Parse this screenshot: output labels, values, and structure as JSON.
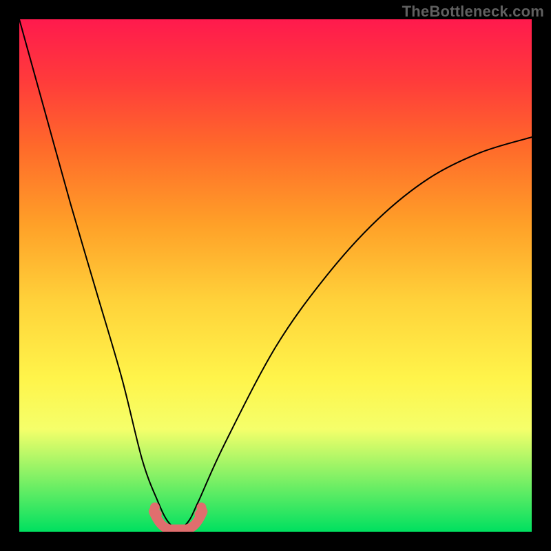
{
  "watermark": "TheBottleneck.com",
  "chart_data": {
    "type": "line",
    "title": "",
    "xlabel": "",
    "ylabel": "",
    "xlim": [
      0,
      1
    ],
    "ylim": [
      0,
      1
    ],
    "note": "Axes are implicit and unlabeled in the image; x/y are normalized 0–1 estimates read from pixel positions.",
    "series": [
      {
        "name": "bottleneck-curve",
        "x": [
          0.0,
          0.05,
          0.1,
          0.15,
          0.2,
          0.24,
          0.27,
          0.29,
          0.31,
          0.33,
          0.35,
          0.4,
          0.5,
          0.6,
          0.7,
          0.8,
          0.9,
          1.0
        ],
        "y": [
          1.0,
          0.82,
          0.64,
          0.47,
          0.3,
          0.14,
          0.06,
          0.02,
          0.005,
          0.02,
          0.06,
          0.17,
          0.36,
          0.5,
          0.61,
          0.69,
          0.74,
          0.77
        ]
      }
    ],
    "min_region": {
      "x_start": 0.27,
      "x_end": 0.35,
      "y": 0.01
    },
    "background_gradient": {
      "top": "#ff1a4d",
      "bottom": "#00e060"
    }
  }
}
